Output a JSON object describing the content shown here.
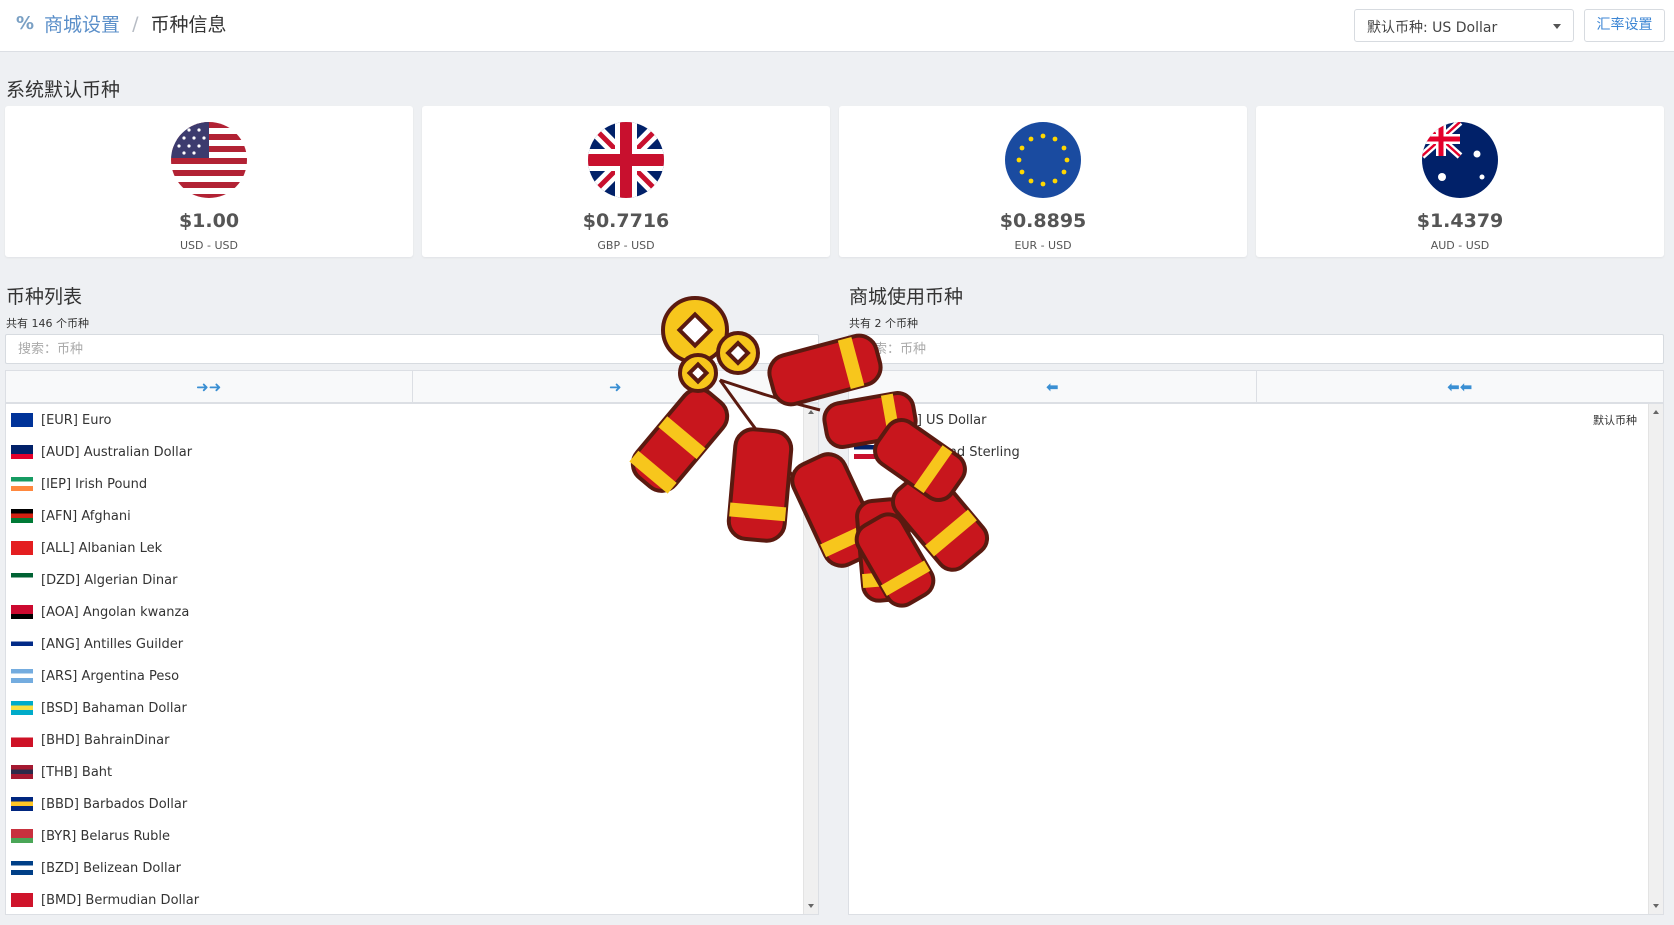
{
  "header": {
    "breadcrumb_root": "商城设置",
    "breadcrumb_sep": "/",
    "breadcrumb_current": "币种信息",
    "default_currency": "默认币种: US Dollar",
    "rate_button": "汇率设置"
  },
  "defaults_section": {
    "title": "系统默认币种",
    "cards": [
      {
        "price": "$1.00",
        "pair": "USD - USD",
        "icon": "us-flag-icon"
      },
      {
        "price": "$0.7716",
        "pair": "GBP - USD",
        "icon": "uk-flag-icon"
      },
      {
        "price": "$0.8895",
        "pair": "EUR - USD",
        "icon": "eu-flag-icon"
      },
      {
        "price": "$1.4379",
        "pair": "AUD - USD",
        "icon": "au-flag-icon"
      }
    ]
  },
  "currency_list": {
    "title": "币种列表",
    "count": "共有 146 个币种",
    "search_placeholder": "搜索：币种",
    "move_all": "➜➜",
    "move_one": "➜",
    "items": [
      {
        "label": "[EUR] Euro",
        "flag": [
          "#003399",
          "#003399",
          "#003399"
        ]
      },
      {
        "label": "[AUD] Australian Dollar",
        "flag": [
          "#012169",
          "#012169",
          "#e4002b"
        ]
      },
      {
        "label": "[IEP] Irish Pound",
        "flag": [
          "#169b62",
          "#ffffff",
          "#ff883e"
        ]
      },
      {
        "label": "[AFN] Afghani",
        "flag": [
          "#000000",
          "#d32011",
          "#007a36"
        ]
      },
      {
        "label": "[ALL] Albanian Lek",
        "flag": [
          "#e41e20",
          "#e41e20",
          "#e41e20"
        ]
      },
      {
        "label": "[DZD] Algerian Dinar",
        "flag": [
          "#006233",
          "#ffffff",
          "#ffffff"
        ]
      },
      {
        "label": "[AOA] Angolan kwanza",
        "flag": [
          "#cc092f",
          "#cc092f",
          "#000000"
        ]
      },
      {
        "label": "[ANG] Antilles Guilder",
        "flag": [
          "#ffffff",
          "#012a87",
          "#ffffff"
        ]
      },
      {
        "label": "[ARS] Argentina Peso",
        "flag": [
          "#74acdf",
          "#ffffff",
          "#74acdf"
        ]
      },
      {
        "label": "[BSD] Bahaman Dollar",
        "flag": [
          "#00abc9",
          "#fae042",
          "#00abc9"
        ]
      },
      {
        "label": "[BHD] BahrainDinar",
        "flag": [
          "#ffffff",
          "#ce1126",
          "#ce1126"
        ]
      },
      {
        "label": "[THB] Baht",
        "flag": [
          "#a51931",
          "#2d2a4a",
          "#a51931"
        ]
      },
      {
        "label": "[BBD] Barbados Dollar",
        "flag": [
          "#00267f",
          "#ffc726",
          "#00267f"
        ]
      },
      {
        "label": "[BYR] Belarus Ruble",
        "flag": [
          "#c8313e",
          "#c8313e",
          "#4aa657"
        ]
      },
      {
        "label": "[BZD] Belizean Dollar",
        "flag": [
          "#003f87",
          "#ffffff",
          "#003f87"
        ]
      },
      {
        "label": "[BMD] Bermudian Dollar",
        "flag": [
          "#cf142b",
          "#cf142b",
          "#cf142b"
        ]
      }
    ]
  },
  "store_list": {
    "title": "商城使用币种",
    "count": "共有 2 个币种",
    "search_placeholder": "搜索：币种",
    "remove_one": "⬅",
    "remove_all": "⬅⬅",
    "items": [
      {
        "label": "[USD] US Dollar",
        "tag": "默认币种",
        "flag": [
          "#b22234",
          "#ffffff",
          "#3c3b6e"
        ]
      },
      {
        "label": "[GBP] Pound Sterling",
        "tag": "",
        "flag": [
          "#012169",
          "#ffffff",
          "#c8102e"
        ]
      }
    ]
  }
}
